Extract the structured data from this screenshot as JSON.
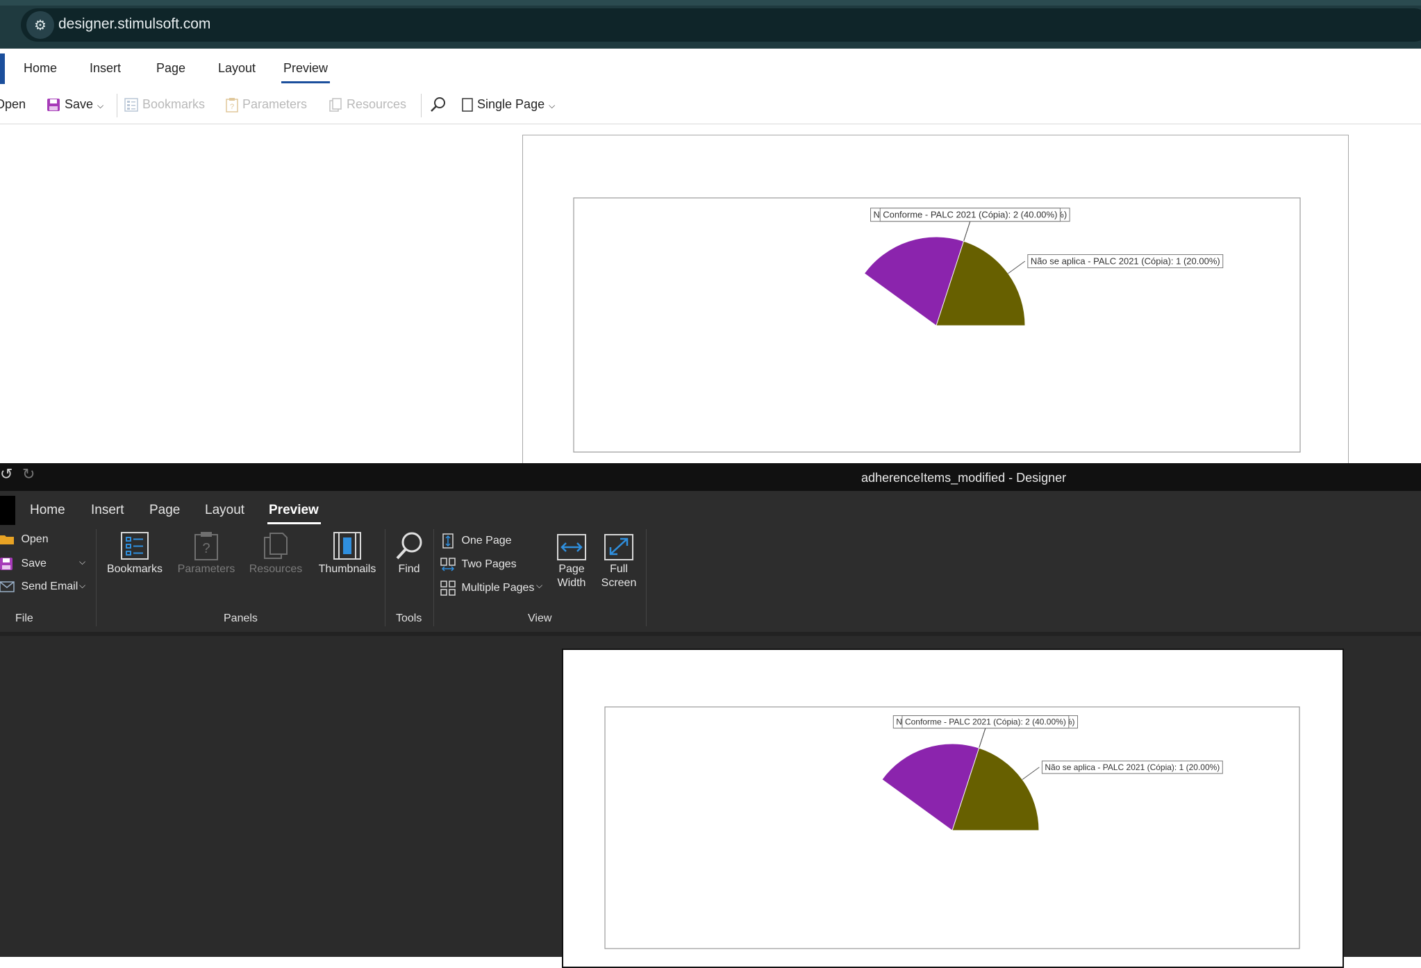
{
  "browser": {
    "url": "designer.stimulsoft.com",
    "site_icon": "tune-icon"
  },
  "web": {
    "tabs": [
      {
        "label": "Home"
      },
      {
        "label": "Insert"
      },
      {
        "label": "Page"
      },
      {
        "label": "Layout"
      },
      {
        "label": "Preview",
        "active": true
      }
    ],
    "toolbar": {
      "open_label": "Open",
      "save_label": "Save",
      "bookmarks_label": "Bookmarks",
      "parameters_label": "Parameters",
      "resources_label": "Resources",
      "view_mode_label": "Single Page"
    }
  },
  "desktop": {
    "title": "adherenceItems_modified - Designer",
    "tabs": [
      {
        "label": "Home"
      },
      {
        "label": "Insert"
      },
      {
        "label": "Page"
      },
      {
        "label": "Layout"
      },
      {
        "label": "Preview",
        "active": true
      }
    ],
    "file": {
      "open_label": "Open",
      "save_label": "Save",
      "send_email_label": "Send Email",
      "group_label": "File"
    },
    "panels": {
      "bookmarks_label": "Bookmarks",
      "parameters_label": "Parameters",
      "resources_label": "Resources",
      "thumbnails_label": "Thumbnails",
      "group_label": "Panels"
    },
    "tools": {
      "find_label": "Find",
      "group_label": "Tools"
    },
    "view": {
      "one_page_label": "One Page",
      "two_pages_label": "Two Pages",
      "multiple_pages_label": "Multiple Pages",
      "page_width_line1": "Page",
      "page_width_line2": "Width",
      "full_screen_line1": "Full",
      "full_screen_line2": "Screen",
      "group_label": "View"
    }
  },
  "colors": {
    "nao_conforme": "#c00000",
    "nao_se_aplica": "#676000",
    "conforme": "#8b24ad"
  },
  "chart_data": [
    {
      "type": "pie",
      "title": "",
      "categories": [
        "Não Conforme - PALC 2021 (Cópia)",
        "Conforme - PALC 2021 (Cópia)",
        "Não se aplica - PALC 2021 (Cópia)"
      ],
      "values": [
        2,
        2,
        1
      ],
      "labels": [
        "Não Conforme - PALC 2021 (Cópia): 2 (40.00%)",
        "Conforme - PALC 2021 (Cópia): 2 (40.00%)",
        "Não se aplica - PALC 2021 (Cópia): 1 (20.00%)"
      ]
    },
    {
      "type": "pie",
      "title": "",
      "categories": [
        "Não Conforme - PALC 2021 (Cópia)",
        "Conforme - PALC 2021 (Cópia)",
        "Não se aplica - PALC 2021 (Cópia)"
      ],
      "values": [
        2,
        2,
        1
      ],
      "labels": [
        "Não Conforme - PALC 2021 (Cópia): 2 (40.00%)",
        "Conforme - PALC 2021 (Cópia): 2 (40.00%)",
        "Não se aplica - PALC 2021 (Cópia): 1 (20.00%)"
      ]
    }
  ]
}
